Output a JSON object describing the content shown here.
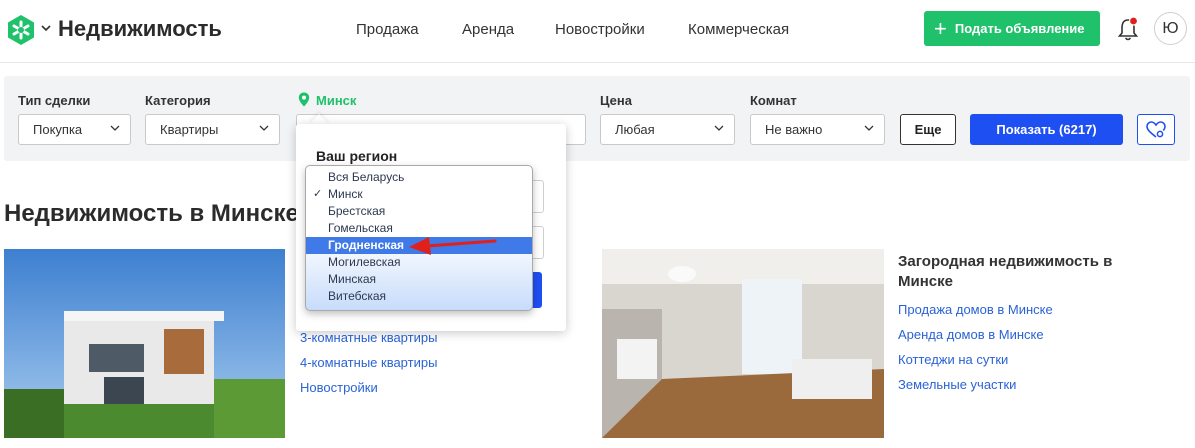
{
  "header": {
    "brand": "Недвижимость",
    "nav": [
      "Продажа",
      "Аренда",
      "Новостройки",
      "Коммерческая"
    ],
    "post_button": "Подать объявление",
    "avatar_letter": "Ю"
  },
  "filters": {
    "deal_type": {
      "label": "Тип сделки",
      "value": "Покупка"
    },
    "category": {
      "label": "Категория",
      "value": "Квартиры"
    },
    "city": {
      "label": "Минск"
    },
    "price": {
      "label": "Цена",
      "value": "Любая"
    },
    "rooms": {
      "label": "Комнат",
      "value": "Не важно"
    },
    "more_button": "Еще",
    "show_button": "Показать (6217)"
  },
  "region_popup": {
    "title": "Ваш регион",
    "options": [
      "Вся Беларусь",
      "Минск",
      "Брестская",
      "Гомельская",
      "Гродненская",
      "Могилевская",
      "Минская",
      "Витебская"
    ],
    "checked": "Минск",
    "highlighted": "Гродненская"
  },
  "section": {
    "heading": "Недвижимость в Минске",
    "apartment_links": [
      "3-комнатные квартиры",
      "4-комнатные квартиры",
      "Новостройки"
    ],
    "country_title": "Загородная недвижимость в Минске",
    "country_links": [
      "Продажа домов в Минске",
      "Аренда домов в Минске",
      "Коттеджи на сутки",
      "Земельные участки"
    ]
  },
  "colors": {
    "green": "#1fc16b",
    "blue": "#1e4ff2",
    "link": "#2a63d6",
    "annotation_arrow": "#e0201b"
  }
}
